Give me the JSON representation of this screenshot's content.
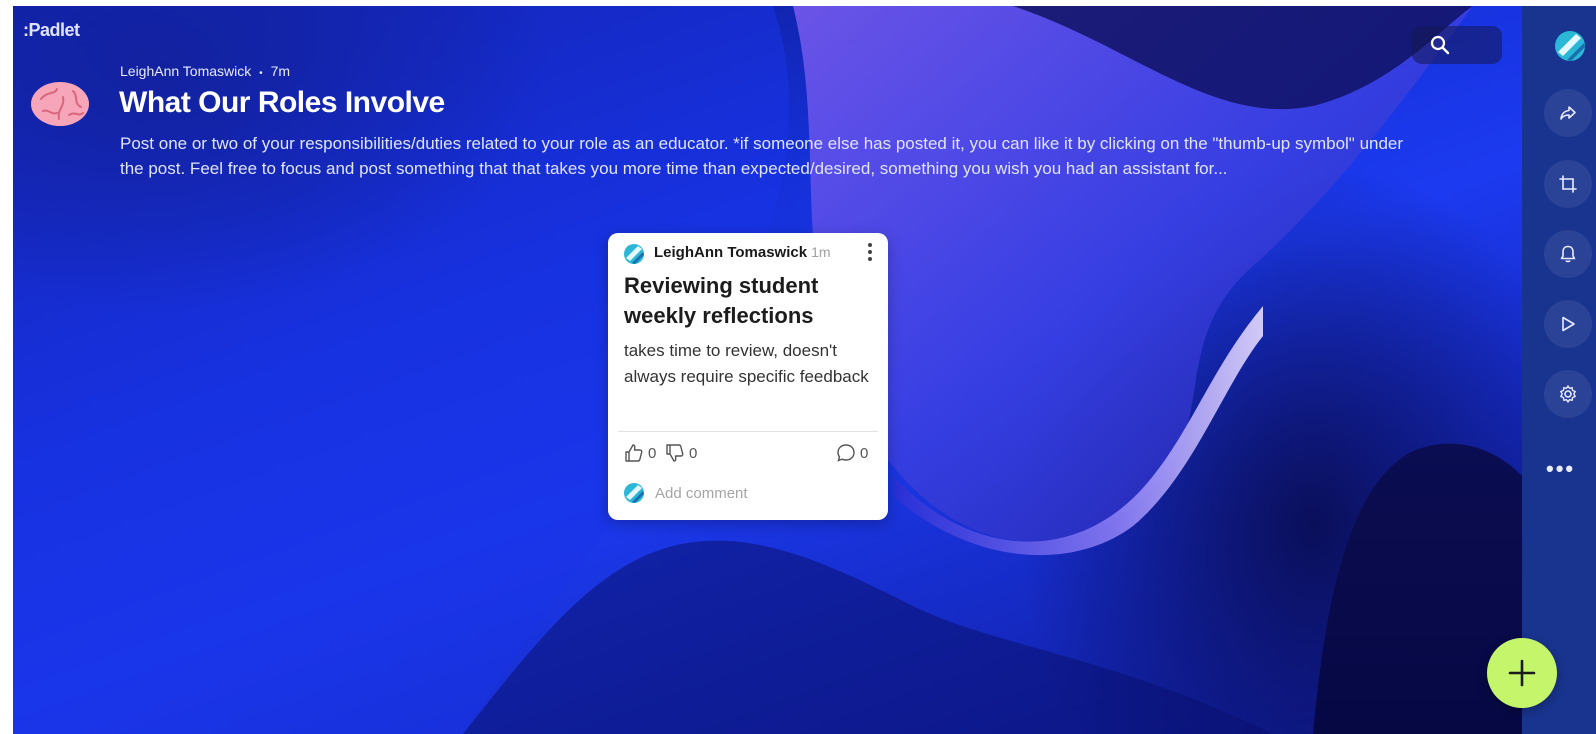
{
  "app": {
    "logo": ":Padlet"
  },
  "header": {
    "author": "LeighAnn Tomaswick",
    "separator": "•",
    "time": "7m",
    "title": "What Our Roles Involve",
    "description": "Post one or two of your responsibilities/duties related to your role as an educator.  *if someone else has posted it, you can like it by clicking on the \"thumb-up symbol\"  under the post. Feel free to focus and post something that that takes you more time than expected/desired, something you wish you had an assistant for..."
  },
  "post": {
    "author": "LeighAnn Tomaswick",
    "time": "1m",
    "title": "Reviewing student weekly reflections",
    "body": "takes time to review, doesn't always require specific feedback",
    "likes": "0",
    "dislikes": "0",
    "comments": "0",
    "add_comment": "Add comment"
  },
  "sidebar": {
    "items": [
      {
        "icon": "share-icon"
      },
      {
        "icon": "remake-icon"
      },
      {
        "icon": "bell-icon"
      },
      {
        "icon": "slideshow-play-icon"
      },
      {
        "icon": "gear-icon"
      },
      {
        "icon": "more-icon",
        "label": "•••"
      }
    ]
  },
  "colors": {
    "fab": "#c5f56a",
    "sidebar": "#19348f",
    "accent_blue": "#1c3af0"
  }
}
